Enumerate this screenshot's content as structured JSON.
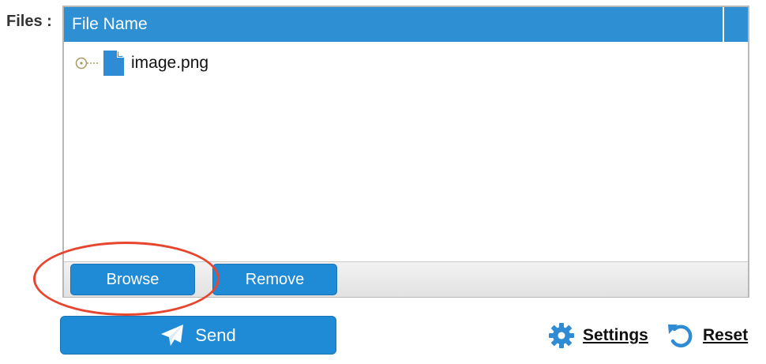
{
  "form": {
    "files_label": "Files :"
  },
  "file_grid": {
    "column_header": "File Name",
    "files": [
      {
        "name": "image.png",
        "icon": "file-icon"
      }
    ]
  },
  "toolbar": {
    "browse_label": "Browse",
    "remove_label": "Remove"
  },
  "actions": {
    "send_label": "Send",
    "settings_label": "Settings",
    "reset_label": "Reset"
  },
  "colors": {
    "accent": "#1f8ad6",
    "header": "#2e8fd3",
    "highlight": "#e8452f"
  },
  "icons": {
    "send": "paper-plane-icon",
    "settings": "gear-icon",
    "reset": "undo-icon",
    "tree_node": "tree-node-icon"
  }
}
